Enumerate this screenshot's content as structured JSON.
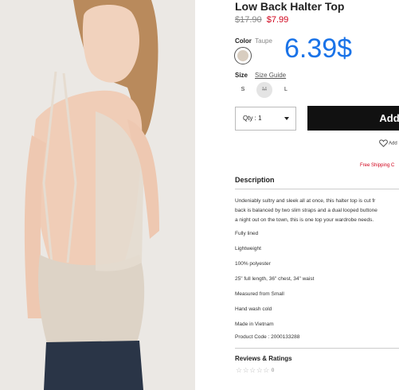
{
  "product": {
    "title": "Low Back Halter Top",
    "price_original": "$17.90",
    "price_sale": "$7.99",
    "price_overlay": "6.39$"
  },
  "color": {
    "label": "Color",
    "value": "Taupe",
    "swatch_hex": "#d8cdc0"
  },
  "size": {
    "label": "Size",
    "guide_label": "Size Guide",
    "options": [
      "S",
      "M",
      "L"
    ],
    "unavailable": "M"
  },
  "quantity": {
    "label": "Qty : 1"
  },
  "actions": {
    "add_label": "Add",
    "wishlist_label": "Add",
    "free_shipping": "Free Shipping C"
  },
  "description": {
    "heading": "Description",
    "lines": [
      "Undeniably sultry and sleek all at once, this halter top is cut fr",
      "back is balanced by two slim straps and a dual looped buttone",
      "a night out on the town, this is one top your wardrobe needs."
    ],
    "features": [
      "Fully lined",
      "Lightweight",
      "100% polyester",
      "25\" full length, 36\" chest, 34\" waist",
      "Measured from Small",
      "Hand wash cold",
      "Made in Vietnam",
      "Product Code : 2000133288"
    ]
  },
  "reviews": {
    "heading": "Reviews & Ratings",
    "stars": "☆☆☆☆☆",
    "count": "0"
  },
  "colors": {
    "accent_price": "#1a73e8",
    "sale_red": "#d0021b",
    "button_bg": "#111111"
  }
}
